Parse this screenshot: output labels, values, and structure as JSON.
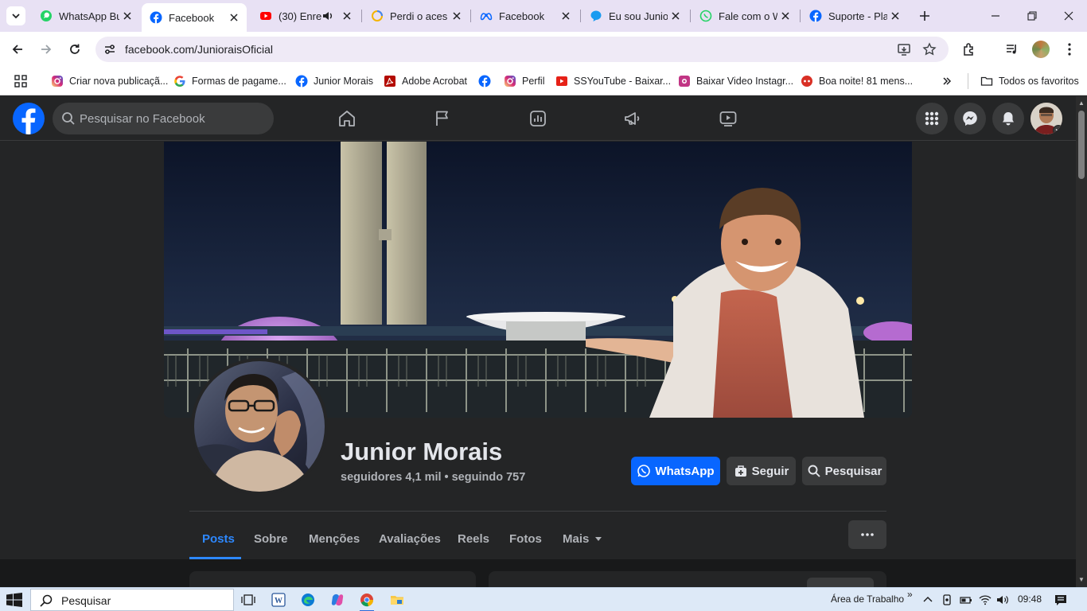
{
  "browser": {
    "tabs": [
      {
        "title": "WhatsApp Bu",
        "icon": "whatsapp-icon",
        "active": false
      },
      {
        "title": "Facebook",
        "icon": "facebook-icon",
        "active": true
      },
      {
        "title": "(30) Enre",
        "icon": "youtube-icon",
        "active": false,
        "audio": true
      },
      {
        "title": "Perdi o aces",
        "icon": "loading-icon",
        "active": false
      },
      {
        "title": "Facebook",
        "icon": "meta-icon",
        "active": false
      },
      {
        "title": "Eu sou Junio",
        "icon": "chat-bubble-icon",
        "active": false
      },
      {
        "title": "Fale com o W",
        "icon": "whatsapp-icon",
        "active": false
      },
      {
        "title": "Suporte - Pla",
        "icon": "facebook-icon",
        "active": false
      }
    ],
    "url": "facebook.com/JunioraisOficial",
    "bookmarks": [
      {
        "label": "Criar nova publicaçã...",
        "icon": "instagram-icon"
      },
      {
        "label": "Formas de pagame...",
        "icon": "google-icon"
      },
      {
        "label": "Junior Morais",
        "icon": "facebook-icon"
      },
      {
        "label": "Adobe Acrobat",
        "icon": "acrobat-icon"
      },
      {
        "label": "",
        "icon": "facebook-icon"
      },
      {
        "label": "Perfil",
        "icon": "instagram-icon"
      },
      {
        "label": "SSYouTube - Baixar...",
        "icon": "youtube-icon"
      },
      {
        "label": "Baixar Video Instagr...",
        "icon": "instagram-download-icon"
      },
      {
        "label": "Boa noite! 81 mens...",
        "icon": "chat-icon"
      }
    ],
    "all_bookmarks_label": "Todos os favoritos"
  },
  "facebook": {
    "search_placeholder": "Pesquisar no Facebook",
    "nav_icons": [
      "home-icon",
      "flag-icon",
      "insights-icon",
      "megaphone-icon",
      "video-icon"
    ],
    "right_icons": [
      "menu-grid-icon",
      "messenger-icon",
      "bell-icon"
    ]
  },
  "profile": {
    "name": "Junior Morais",
    "followers_label": "seguidores",
    "followers": "4,1 mil",
    "separator": "•",
    "following_label": "seguindo",
    "following": "757",
    "buttons": {
      "whatsapp": "WhatsApp",
      "follow": "Seguir",
      "search": "Pesquisar"
    },
    "tabs": [
      "Posts",
      "Sobre",
      "Menções",
      "Avaliações",
      "Reels",
      "Fotos",
      "Mais"
    ],
    "active_tab": "Posts"
  },
  "taskbar": {
    "search_label": "Pesquisar",
    "desktop_label": "Área de Trabalho",
    "time": "09:48",
    "chevron": "»"
  },
  "colors": {
    "facebook_blue": "#0866ff",
    "active_tab_blue": "#2d88ff",
    "fb_dark_surface": "#242526",
    "fb_dark_bg": "#18191a"
  }
}
